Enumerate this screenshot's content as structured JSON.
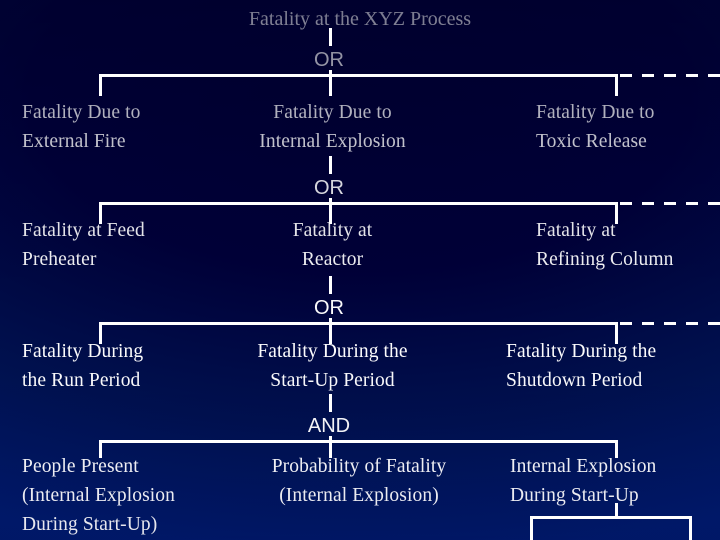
{
  "diagram": {
    "title": "Fatality at the XYZ Process",
    "background_color": "#000033",
    "line_color": "#ffffff",
    "text_color": "#ffffff",
    "type": "fault-tree"
  },
  "gates": {
    "gate1": "OR",
    "gate2": "OR",
    "gate3": "OR",
    "gate4": "AND"
  },
  "levels": [
    {
      "gate": "OR",
      "nodes": [
        "Fatality Due to\nExternal Fire",
        "Fatality Due to\nInternal Explosion",
        "Fatality Due to\nToxic Release"
      ]
    },
    {
      "gate": "OR",
      "nodes": [
        "Fatality at Feed\nPreheater",
        "Fatality at\nReactor",
        "Fatality at\nRefining Column"
      ]
    },
    {
      "gate": "OR",
      "nodes": [
        "Fatality During\nthe Run Period",
        "Fatality During the\nStart-Up Period",
        "Fatality During the\nShutdown Period"
      ]
    },
    {
      "gate": "AND",
      "nodes": [
        "People Present\n(Internal Explosion\nDuring Start-Up)",
        "Probability of Fatality\n(Internal Explosion)",
        "Internal Explosion\nDuring Start-Up"
      ]
    }
  ]
}
